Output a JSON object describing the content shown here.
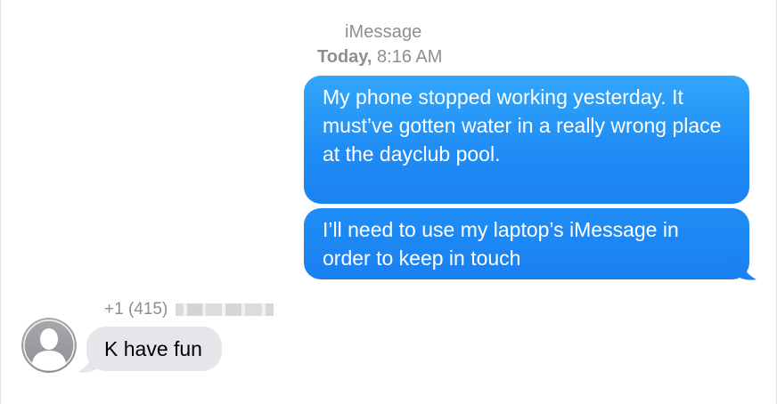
{
  "header": {
    "service": "iMessage",
    "day": "Today,",
    "time": "8:16 AM"
  },
  "messages": [
    {
      "direction": "outgoing",
      "text": "My phone stopped working yesterday. It must’ve gotten water in a really wrong place at the dayclub pool."
    },
    {
      "direction": "outgoing",
      "text": "I’ll need to use my laptop’s iMessage in order to keep in touch"
    },
    {
      "direction": "incoming",
      "sender": "+1 (415)",
      "sender_redacted": true,
      "avatar_icon": "person-silhouette-icon",
      "text": "K have fun"
    }
  ],
  "colors": {
    "outgoing_bubble": "#1f8cf5",
    "incoming_bubble": "#e5e5ea",
    "meta_text": "#8e8e93"
  }
}
